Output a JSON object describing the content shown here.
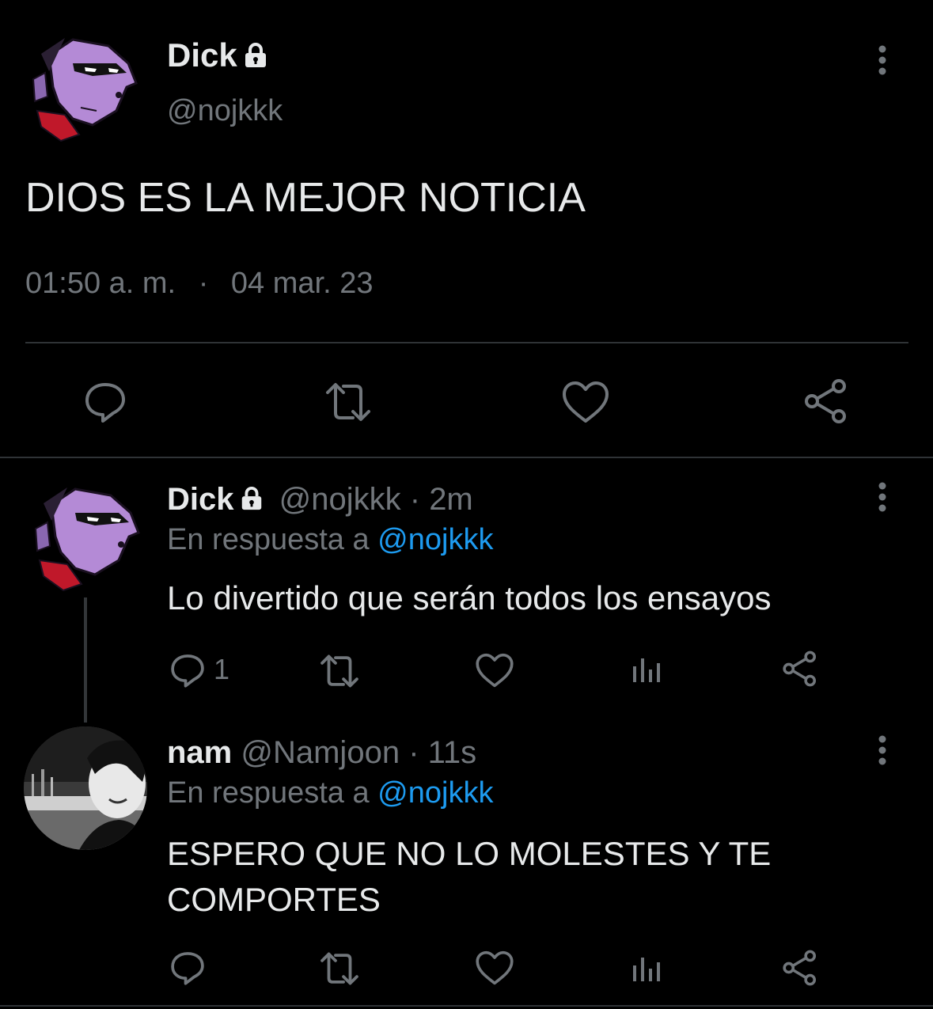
{
  "main_tweet": {
    "display_name": "Dick",
    "handle": "@nojkkk",
    "text": "DIOS ES LA MEJOR NOTICIA",
    "time": "01:50 a. m.",
    "separator": "·",
    "date": "04 mar. 23",
    "avatar_icon": "cartoon-masked-avatar",
    "lock_icon": "lock-icon"
  },
  "replies": [
    {
      "display_name": "Dick",
      "handle": "@nojkkk",
      "sep": "·",
      "age": "2m",
      "replying_prefix": "En respuesta a",
      "replying_to": "@nojkkk",
      "text": "Lo divertido que serán todos los ensayos",
      "reply_count": "1",
      "protected": true
    },
    {
      "display_name": "nam",
      "handle": "@Namjoon",
      "sep": "·",
      "age": "11s",
      "replying_prefix": "En respuesta a",
      "replying_to": "@nojkkk",
      "text_line1": "ESPERO QUE NO LO MOLESTES Y TE",
      "text_line2": "COMPORTES",
      "reply_count": "",
      "protected": false
    }
  ],
  "colors": {
    "background": "#000000",
    "text": "#e7e9ea",
    "muted": "#71767b",
    "link": "#1d9bf0",
    "divider": "#2f3336",
    "avatar_purple": "#b48ad6",
    "avatar_red": "#c0182a"
  }
}
